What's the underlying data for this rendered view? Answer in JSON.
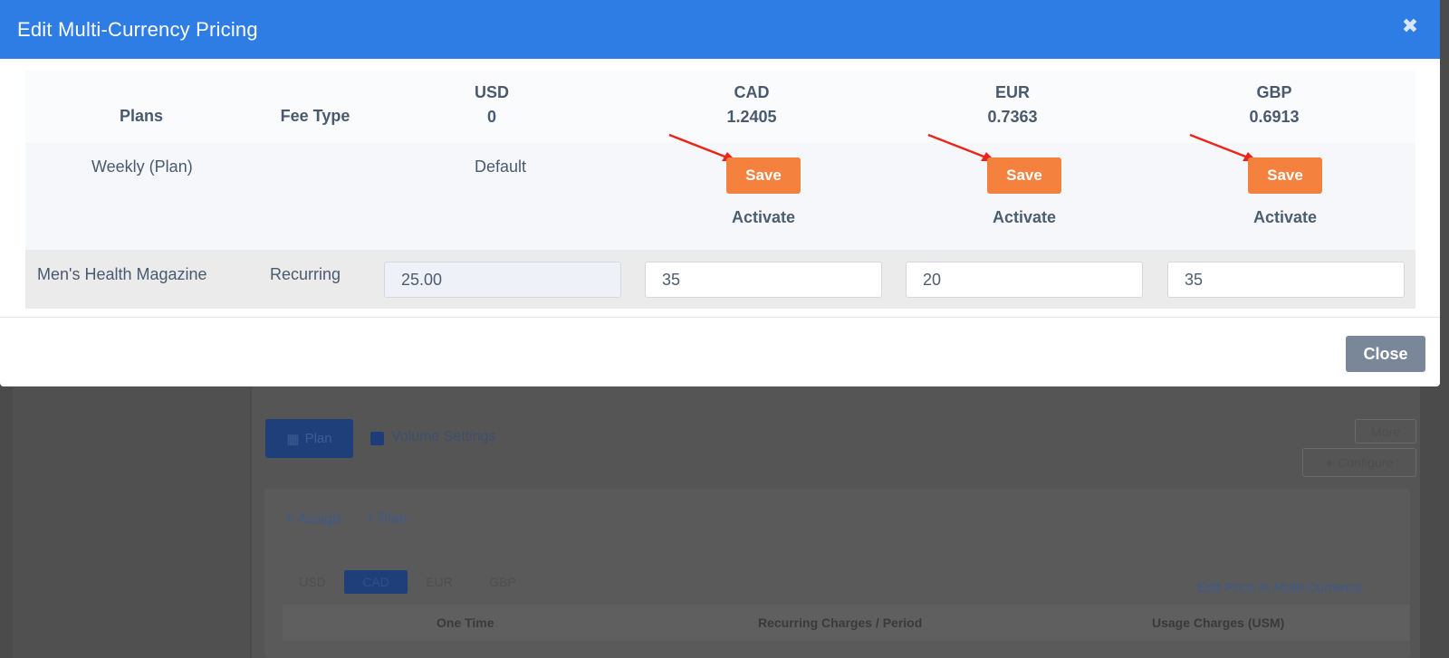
{
  "modal": {
    "title": "Edit Multi-Currency Pricing",
    "close_icon": "close-icon",
    "footer_close_label": "Close"
  },
  "table": {
    "headers": {
      "plans": "Plans",
      "fee_type": "Fee Type",
      "currencies": [
        {
          "code": "USD",
          "rate": "0"
        },
        {
          "code": "CAD",
          "rate": "1.2405"
        },
        {
          "code": "EUR",
          "rate": "0.7363"
        },
        {
          "code": "GBP",
          "rate": "0.6913"
        }
      ]
    },
    "plan_row": {
      "name": "Weekly (Plan)",
      "usd_label": "Default",
      "save_label": "Save",
      "activate_label": "Activate"
    },
    "data_row": {
      "name": "Men's Health Magazine",
      "fee_type": "Recurring",
      "usd_value": "25.00",
      "cad_value": "35",
      "eur_value": "20",
      "gbp_value": "35"
    }
  },
  "background": {
    "plan_button": "Plan",
    "volume_settings": "Volume Settings",
    "assign_link": "+ Assign",
    "plan_link": "+ Plan",
    "more_button": "More",
    "configure_button": "Configure",
    "edit_price_link": "Edit Price in Multi-Currency",
    "tabs": [
      "USD",
      "CAD",
      "EUR",
      "GBP"
    ],
    "columns": [
      "One Time",
      "Recurring Charges / Period",
      "Usage Charges (USM)"
    ]
  },
  "colors": {
    "header_blue": "#2e7de4",
    "save_orange": "#f5813f",
    "close_gray": "#7a8799",
    "arrow_red": "#e8261c"
  }
}
